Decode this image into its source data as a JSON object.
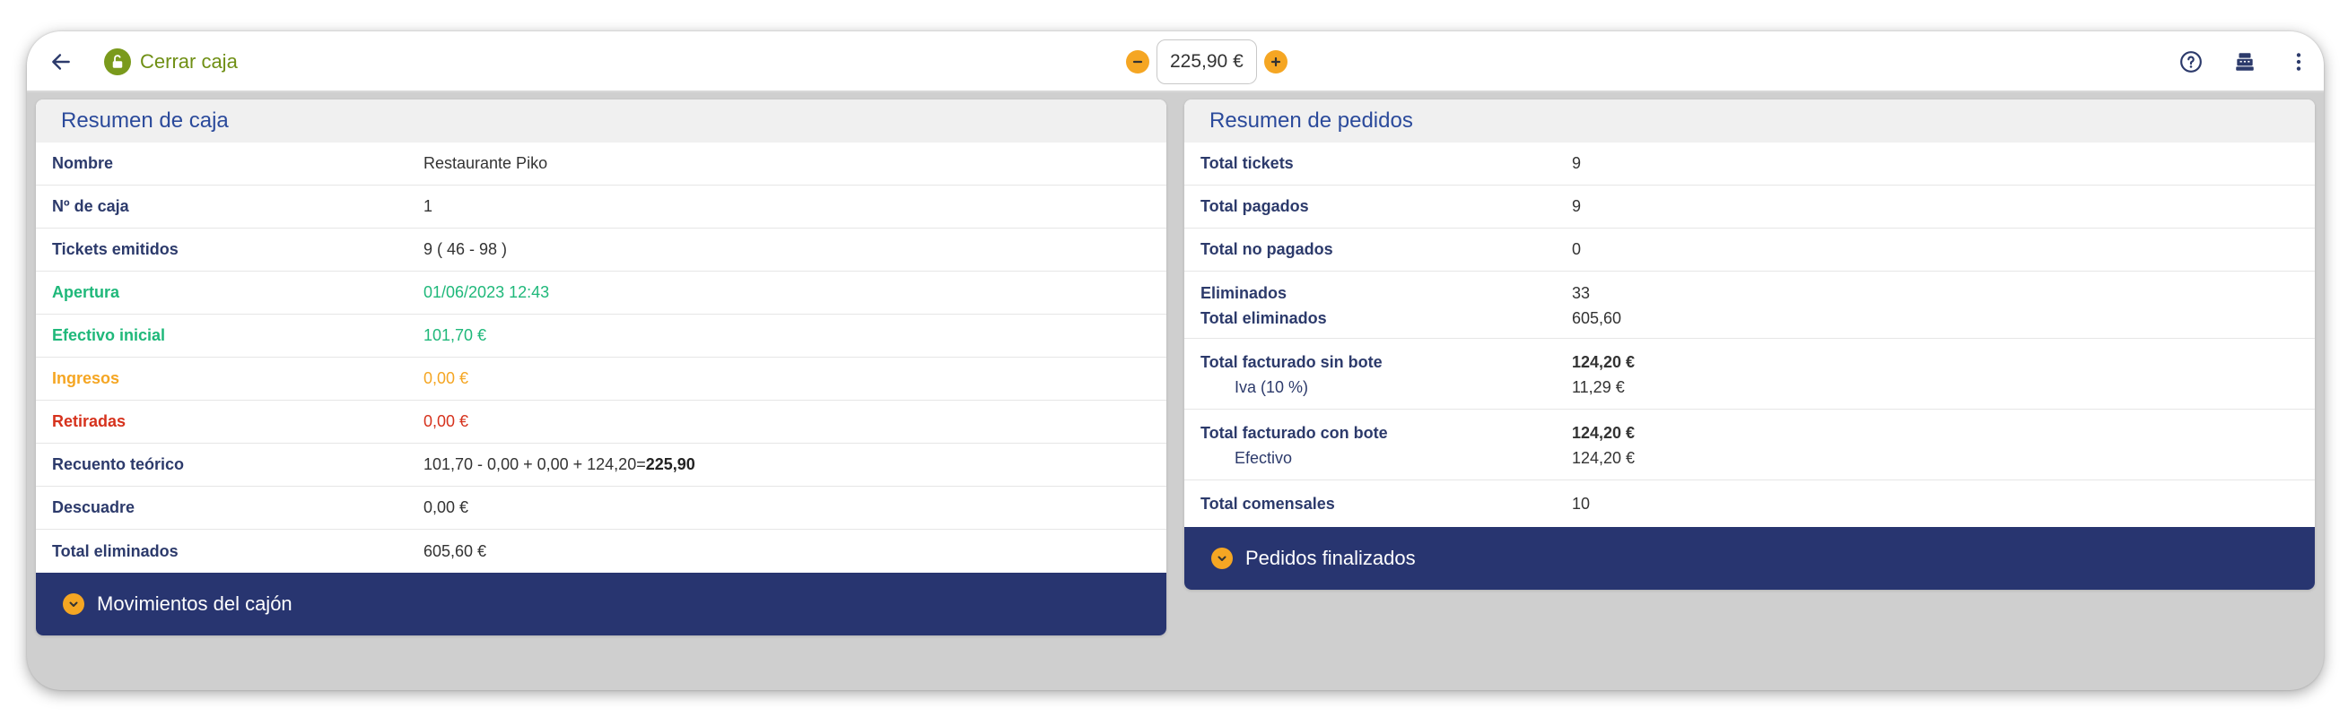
{
  "header": {
    "title": "Cerrar caja",
    "amount": "225,90 €",
    "icons": [
      "back-arrow-icon",
      "unlock-icon",
      "minus-icon",
      "plus-icon",
      "help-icon",
      "cash-register-icon",
      "more-vert-icon"
    ]
  },
  "colors": {
    "navy": "#283570",
    "title_green": "#6f8f14",
    "accent_orange": "#f5a623",
    "header_blue": "#2b4a9b",
    "green": "#1fb87a",
    "orange": "#f5a623",
    "red": "#d6321d"
  },
  "left_panel": {
    "title": "Resumen de caja",
    "rows": [
      {
        "label": "Nombre",
        "value": "Restaurante Piko"
      },
      {
        "label": "Nº de caja",
        "value": "1"
      },
      {
        "label": "Tickets emitidos",
        "value": "9 ( 46 - 98 )"
      },
      {
        "label": "Apertura",
        "value": "01/06/2023 12:43"
      },
      {
        "label": "Efectivo inicial",
        "value": "101,70 €"
      },
      {
        "label": "Ingresos",
        "value": "0,00 €"
      },
      {
        "label": "Retiradas",
        "value": "0,00 €"
      },
      {
        "label": "Recuento teórico",
        "value": "101,70 - 0,00 + 0,00 + 124,20=",
        "value_bold": "225,90"
      },
      {
        "label": "Descuadre",
        "value": "0,00 €"
      },
      {
        "label": "Total eliminados",
        "value": "605,60 €"
      }
    ],
    "footer": "Movimientos del cajón"
  },
  "right_panel": {
    "title": "Resumen de pedidos",
    "rows": [
      {
        "label": "Total tickets",
        "value": "9"
      },
      {
        "label": "Total pagados",
        "value": "9"
      },
      {
        "label": "Total no pagados",
        "value": "0"
      }
    ],
    "eliminados": {
      "label": "Eliminados",
      "value": "33",
      "label2": "Total eliminados",
      "value2": "605,60"
    },
    "sin_bote": {
      "label": "Total facturado sin bote",
      "value": "124,20 €",
      "sub_label": "Iva (10 %)",
      "sub_value": "11,29 €"
    },
    "con_bote": {
      "label": "Total facturado con bote",
      "value": "124,20 €",
      "sub_label": "Efectivo",
      "sub_value": "124,20 €"
    },
    "comensales": {
      "label": "Total comensales",
      "value": "10"
    },
    "footer": "Pedidos finalizados"
  }
}
